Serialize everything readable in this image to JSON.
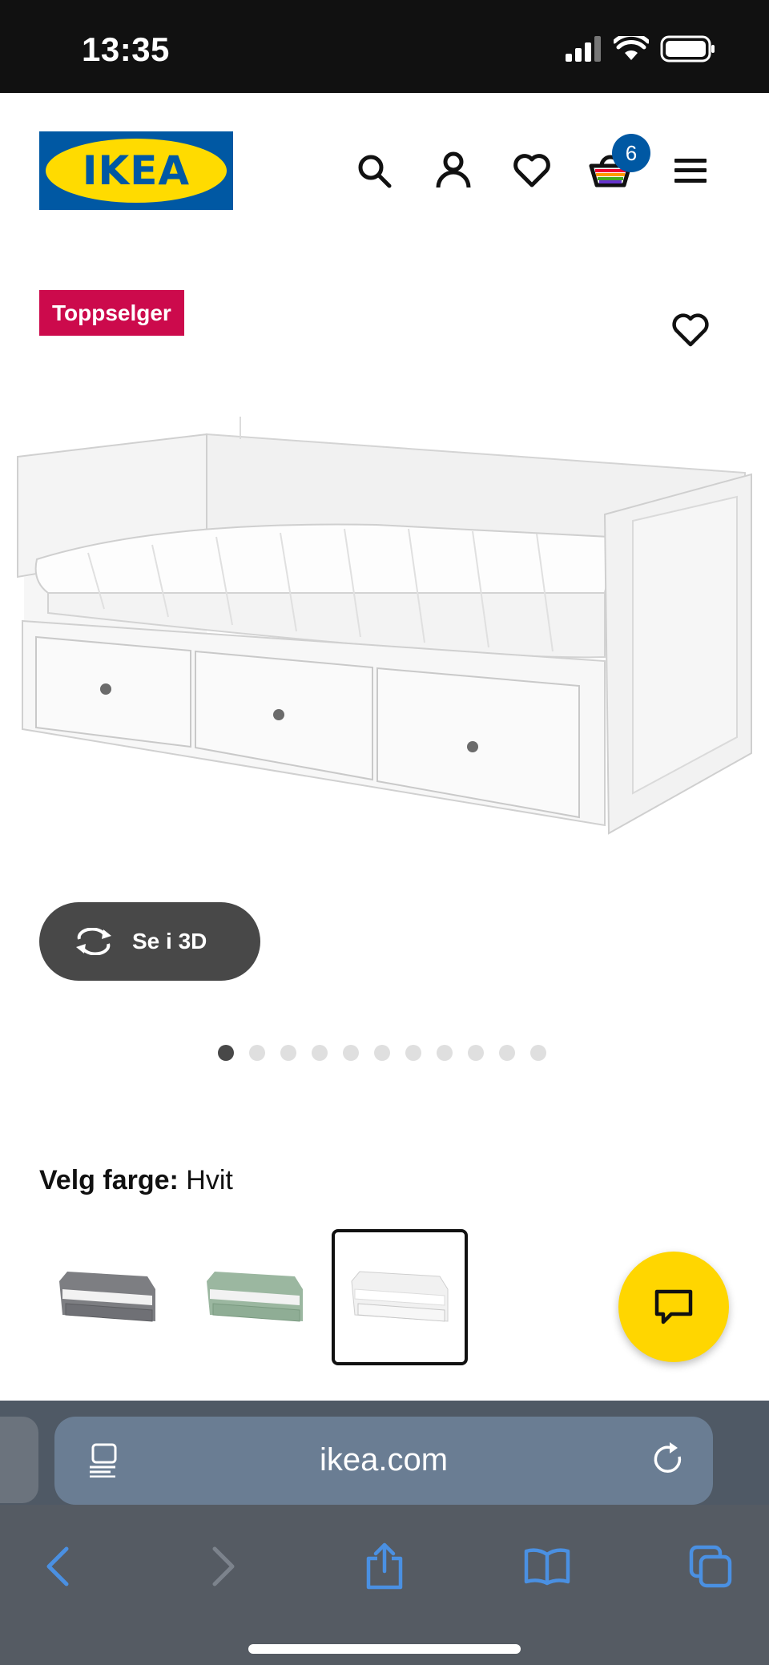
{
  "status_bar": {
    "time": "13:35"
  },
  "header": {
    "logo_text": "IKEA",
    "cart_count": "6",
    "icons": [
      "search-icon",
      "account-icon",
      "heart-icon",
      "cart-icon",
      "menu-icon"
    ]
  },
  "product": {
    "badge": "Toppselger",
    "view_3d_label": "Se i 3D",
    "image_count": 11,
    "active_image": 1
  },
  "color_selector": {
    "label": "Velg farge:",
    "selected_value": "Hvit",
    "swatches": [
      {
        "name": "grey",
        "color": "#7d7e82"
      },
      {
        "name": "green",
        "color": "#9bb7a0"
      },
      {
        "name": "white",
        "color": "#f3f3f3",
        "selected": true
      }
    ]
  },
  "browser": {
    "url": "ikea.com"
  },
  "colors": {
    "ikea_blue": "#0058a3",
    "ikea_yellow": "#ffdb00",
    "badge_red": "#cc0a4c",
    "safari_blue": "#4a90e2"
  }
}
